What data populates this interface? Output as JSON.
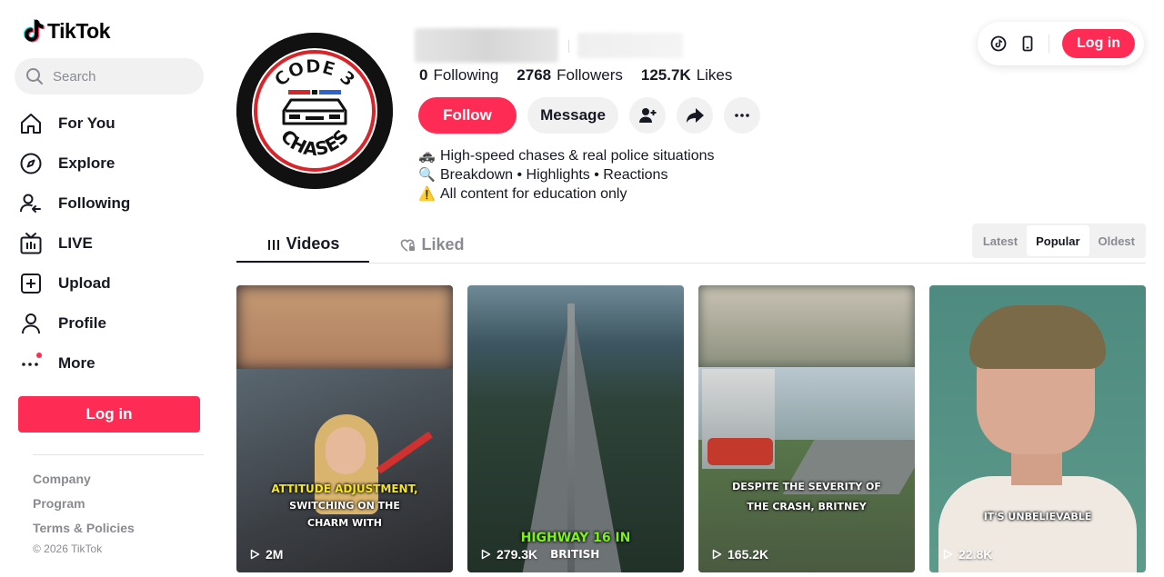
{
  "brand": {
    "name": "TikTok"
  },
  "search": {
    "placeholder": "Search"
  },
  "nav": [
    {
      "label": "For You",
      "icon": "home-icon"
    },
    {
      "label": "Explore",
      "icon": "compass-icon"
    },
    {
      "label": "Following",
      "icon": "following-icon"
    },
    {
      "label": "LIVE",
      "icon": "live-tv-icon"
    },
    {
      "label": "Upload",
      "icon": "upload-icon"
    },
    {
      "label": "Profile",
      "icon": "profile-icon"
    },
    {
      "label": "More",
      "icon": "more-dots-icon"
    }
  ],
  "sidebar_login": "Log in",
  "footer": {
    "links": [
      "Company",
      "Program",
      "Terms & Policies"
    ],
    "copyright": "© 2026 TikTok"
  },
  "topbar": {
    "login": "Log in"
  },
  "profile": {
    "avatar_text_top": "CODE 3",
    "avatar_text_bottom": "CHASES",
    "stats": [
      {
        "value": "0",
        "label": "Following"
      },
      {
        "value": "2768",
        "label": "Followers"
      },
      {
        "value": "125.7K",
        "label": "Likes"
      }
    ],
    "follow": "Follow",
    "message": "Message",
    "bio": [
      {
        "emoji": "🚓",
        "text": "High-speed chases & real police situations"
      },
      {
        "emoji": "🔍",
        "text": "Breakdown • Highlights • Reactions"
      },
      {
        "emoji": "⚠️",
        "text": "All content for education only"
      }
    ]
  },
  "tabs": {
    "videos": "Videos",
    "liked": "Liked"
  },
  "sort": [
    "Latest",
    "Popular",
    "Oldest"
  ],
  "sort_active": "Popular",
  "videos": [
    {
      "views": "2M",
      "caption": [
        "ATTITUDE ADJUSTMENT,",
        "SWITCHING ON THE",
        "CHARM WITH"
      ]
    },
    {
      "views": "279.3K",
      "caption": [
        "HIGHWAY 16 IN",
        "BRITISH"
      ]
    },
    {
      "views": "165.2K",
      "caption": [
        "DESPITE THE SEVERITY OF",
        "THE CRASH, BRITNEY"
      ]
    },
    {
      "views": "22.8K",
      "caption": [
        "IT'S UNBELIEVABLE"
      ]
    }
  ],
  "colors": {
    "accent": "#fe2c55",
    "text": "#161823",
    "muted": "#8a8b91"
  }
}
